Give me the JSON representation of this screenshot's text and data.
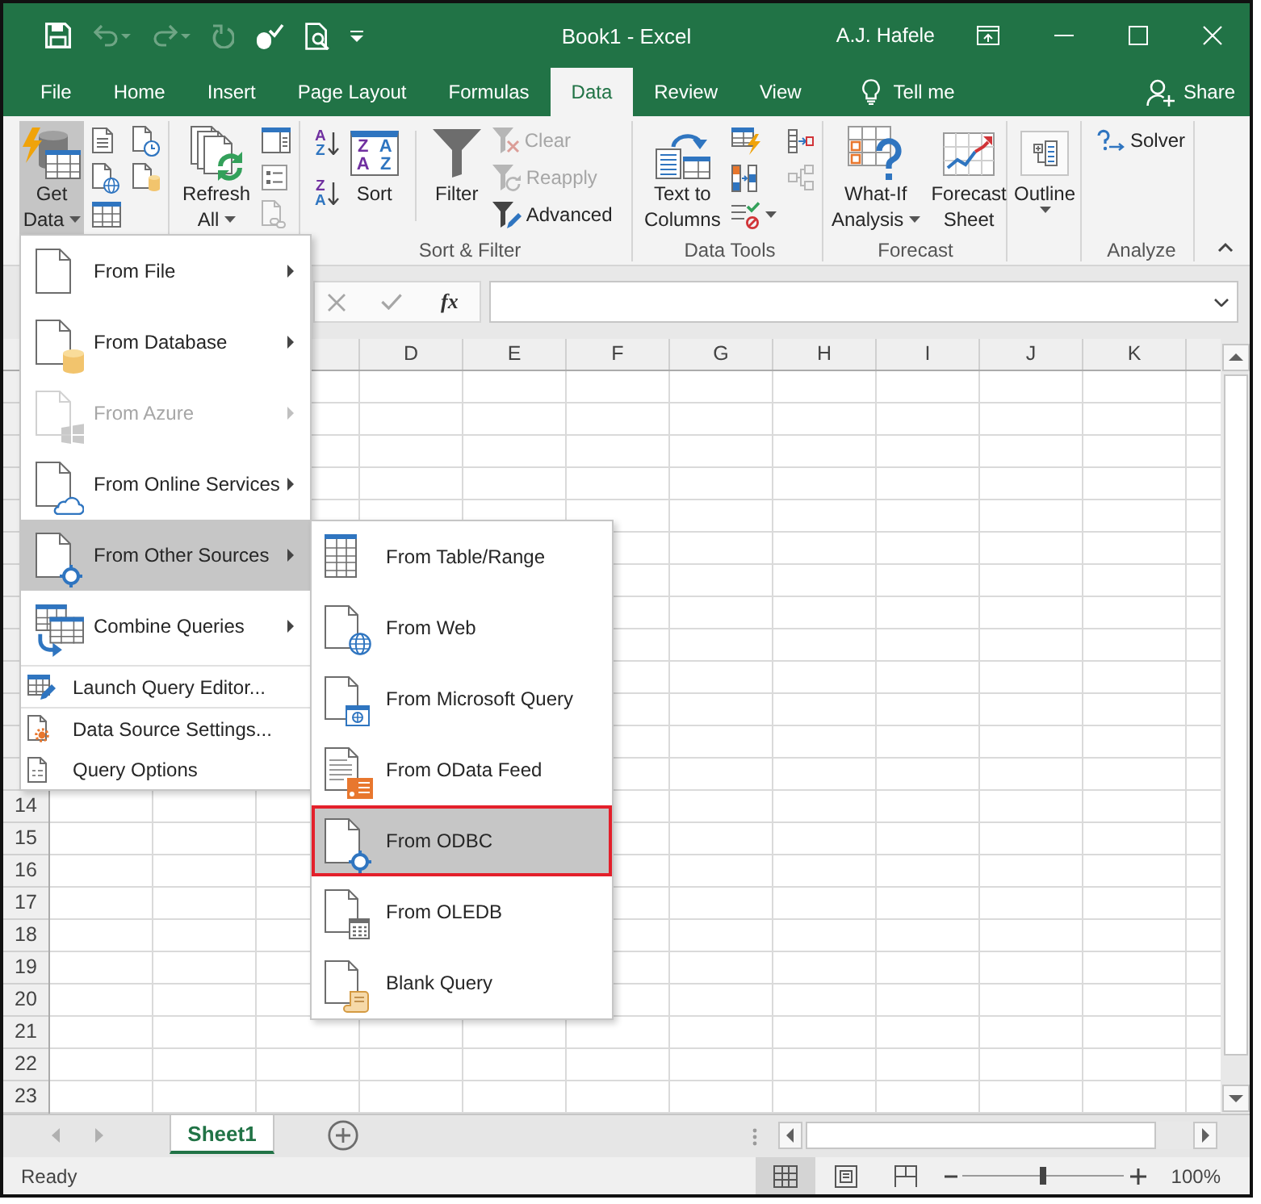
{
  "window": {
    "title": "Book1 - Excel",
    "user": "A.J. Hafele"
  },
  "quick_access": [
    {
      "kind": "save",
      "disabled": false
    },
    {
      "kind": "undo",
      "disabled": true
    },
    {
      "kind": "redo",
      "disabled": true
    },
    {
      "kind": "repeat",
      "disabled": true
    },
    {
      "kind": "touch",
      "disabled": false
    },
    {
      "kind": "preview",
      "disabled": false
    },
    {
      "kind": "customize",
      "disabled": false
    }
  ],
  "tabs": [
    {
      "label": "File",
      "selected": false
    },
    {
      "label": "Home",
      "selected": false
    },
    {
      "label": "Insert",
      "selected": false
    },
    {
      "label": "Page Layout",
      "selected": false
    },
    {
      "label": "Formulas",
      "selected": false
    },
    {
      "label": "Data",
      "selected": true
    },
    {
      "label": "Review",
      "selected": false
    },
    {
      "label": "View",
      "selected": false
    }
  ],
  "tell_me": "Tell me",
  "share": "Share",
  "ribbon": {
    "groups": [
      {
        "controls": [
          {
            "kind": "large",
            "lines": [
              "Get",
              "Data"
            ],
            "dropdown": true,
            "expanded": true,
            "disabled": false
          },
          {
            "kind": "small",
            "dropdown": false,
            "expanded": false,
            "disabled": false
          },
          {
            "kind": "small",
            "dropdown": false,
            "expanded": false,
            "disabled": false
          },
          {
            "kind": "small",
            "dropdown": false,
            "expanded": false,
            "disabled": false
          },
          {
            "kind": "small",
            "dropdown": false,
            "expanded": false,
            "disabled": false
          },
          {
            "kind": "small",
            "dropdown": false,
            "expanded": false,
            "disabled": false
          }
        ]
      },
      {
        "controls": [
          {
            "kind": "large",
            "lines": [
              "Refresh",
              "All"
            ],
            "dropdown": true,
            "expanded": false,
            "disabled": false
          },
          {
            "kind": "small",
            "dropdown": false,
            "expanded": false,
            "disabled": false
          },
          {
            "kind": "small",
            "dropdown": false,
            "expanded": false,
            "disabled": false
          },
          {
            "kind": "small",
            "dropdown": false,
            "expanded": false,
            "disabled": true
          }
        ]
      },
      {
        "label": "Sort & Filter",
        "controls": [
          {
            "kind": "small",
            "glyphs": [
              "A",
              "Z"
            ],
            "dropdown": false,
            "expanded": false,
            "disabled": false
          },
          {
            "kind": "small",
            "glyphs": [
              "Z",
              "A"
            ],
            "dropdown": false,
            "expanded": false,
            "disabled": false
          },
          {
            "kind": "large",
            "lines": [
              "Sort"
            ],
            "glyphs": [
              "Z",
              "A",
              "A",
              "Z"
            ],
            "dropdown": false,
            "expanded": false,
            "disabled": false
          },
          {
            "kind": "large",
            "lines": [
              "Filter"
            ],
            "dropdown": false,
            "expanded": false,
            "disabled": false
          },
          {
            "kind": "small",
            "label": "Clear",
            "dropdown": false,
            "expanded": false,
            "disabled": true
          },
          {
            "kind": "small",
            "label": "Reapply",
            "dropdown": false,
            "expanded": false,
            "disabled": true
          },
          {
            "kind": "small",
            "label": "Advanced",
            "dropdown": false,
            "expanded": false,
            "disabled": false
          }
        ]
      },
      {
        "label": "Data Tools",
        "controls": [
          {
            "kind": "large",
            "lines": [
              "Text to",
              "Columns"
            ],
            "dropdown": false,
            "expanded": false,
            "disabled": false
          },
          {
            "kind": "small",
            "dropdown": false,
            "expanded": false,
            "disabled": false
          },
          {
            "kind": "small",
            "dropdown": false,
            "expanded": false,
            "disabled": false
          },
          {
            "kind": "small",
            "dropdown": true,
            "expanded": false,
            "disabled": false
          },
          {
            "kind": "small",
            "dropdown": false,
            "expanded": false,
            "disabled": false
          },
          {
            "kind": "small",
            "dropdown": false,
            "expanded": false,
            "disabled": true
          }
        ]
      },
      {
        "label": "Forecast",
        "controls": [
          {
            "kind": "large",
            "lines": [
              "What-If",
              "Analysis"
            ],
            "dropdown": true,
            "expanded": false,
            "disabled": false
          },
          {
            "kind": "large",
            "lines": [
              "Forecast",
              "Sheet"
            ],
            "dropdown": false,
            "expanded": false,
            "disabled": false
          }
        ]
      },
      {
        "controls": [
          {
            "kind": "large",
            "lines": [
              "Outline"
            ],
            "dropdown": true,
            "expanded": false,
            "disabled": false
          }
        ]
      },
      {
        "label": "Analyze",
        "controls": [
          {
            "kind": "small",
            "label": "Solver",
            "dropdown": false,
            "expanded": false,
            "disabled": false
          }
        ]
      }
    ]
  },
  "get_data_menu": [
    {
      "kind": "large",
      "label": "From File",
      "submenu": true,
      "disabled": false,
      "selected": false
    },
    {
      "kind": "large",
      "label": "From Database",
      "submenu": true,
      "disabled": false,
      "selected": false
    },
    {
      "kind": "large",
      "label": "From Azure",
      "submenu": true,
      "disabled": true,
      "selected": false
    },
    {
      "kind": "large",
      "label": "From Online Services",
      "submenu": true,
      "disabled": false,
      "selected": false
    },
    {
      "kind": "large",
      "label": "From Other Sources",
      "submenu": true,
      "disabled": false,
      "selected": true
    },
    {
      "kind": "large",
      "label": "Combine Queries",
      "submenu": true,
      "disabled": false,
      "selected": false
    },
    {
      "kind": "separator"
    },
    {
      "kind": "small",
      "label": "Launch Query Editor...",
      "submenu": false,
      "disabled": false,
      "selected": false
    },
    {
      "kind": "separator"
    },
    {
      "kind": "small",
      "label": "Data Source Settings...",
      "submenu": false,
      "disabled": false,
      "selected": false
    },
    {
      "kind": "small",
      "label": "Query Options",
      "submenu": false,
      "disabled": false,
      "selected": false
    }
  ],
  "other_sources_menu": [
    {
      "label": "From Table/Range",
      "selected": false,
      "outlined": false
    },
    {
      "label": "From Web",
      "selected": false,
      "outlined": false
    },
    {
      "label": "From Microsoft Query",
      "selected": false,
      "outlined": false
    },
    {
      "label": "From OData Feed",
      "selected": false,
      "outlined": false
    },
    {
      "label": "From ODBC",
      "selected": true,
      "outlined": true
    },
    {
      "label": "From OLEDB",
      "selected": false,
      "outlined": false
    },
    {
      "label": "Blank Query",
      "selected": false,
      "outlined": false
    }
  ],
  "formula_bar": {
    "function_button": "fx"
  },
  "columns": [
    "D",
    "E",
    "F",
    "G",
    "H",
    "I",
    "J",
    "K"
  ],
  "rows": [
    "14",
    "15",
    "16",
    "17",
    "18",
    "19",
    "20",
    "21",
    "22",
    "23"
  ],
  "sheets": [
    {
      "label": "Sheet1",
      "selected": true
    }
  ],
  "status": "Ready",
  "views": [
    {
      "kind": "normal",
      "selected": true
    },
    {
      "kind": "page-layout",
      "selected": false
    },
    {
      "kind": "page-break",
      "selected": false
    }
  ],
  "zoom": {
    "level": 0.5,
    "reading": "100%"
  }
}
